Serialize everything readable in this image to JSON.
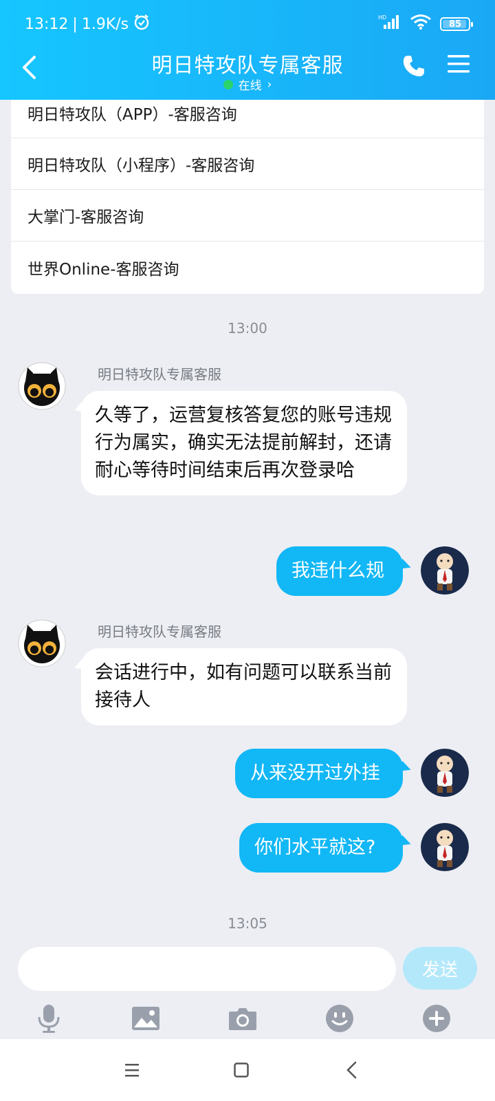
{
  "status_bar": {
    "time": "13:12",
    "speed": "1.9K/s",
    "battery": "85",
    "network": "HD"
  },
  "header": {
    "title": "明日特攻队专属客服",
    "status": "在线",
    "status_chevron": "›"
  },
  "menu": {
    "items": [
      "明日特攻队（APP）-客服咨询",
      "明日特攻队（小程序）-客服咨询",
      "大掌门-客服咨询",
      "世界Online-客服咨询"
    ]
  },
  "chat": {
    "time1": "13:00",
    "time2": "13:05",
    "agent_name": "明日特攻队专属客服",
    "messages": [
      {
        "from": "agent",
        "text": "久等了，运营复核答复您的账号违规行为属实，确实无法提前解封，还请耐心等待时间结束后再次登录哈"
      },
      {
        "from": "me",
        "text": "我违什么规"
      },
      {
        "from": "agent",
        "text": "会话进行中，如有问题可以联系当前接待人"
      },
      {
        "from": "me",
        "text": "从来没开过外挂"
      },
      {
        "from": "me",
        "text": "你们水平就这?"
      }
    ]
  },
  "input": {
    "placeholder": "",
    "send_label": "发送"
  },
  "toolbar": {
    "icons": [
      "mic-icon",
      "image-icon",
      "camera-icon",
      "emoji-icon",
      "plus-icon"
    ]
  },
  "navbar": {
    "icons": [
      "recents-icon",
      "home-icon",
      "back-icon"
    ]
  },
  "colors": {
    "header": "#16c6ff",
    "bubble_out": "#12b7f5",
    "send_disabled": "#b3e8fb",
    "background": "#eceef3"
  }
}
